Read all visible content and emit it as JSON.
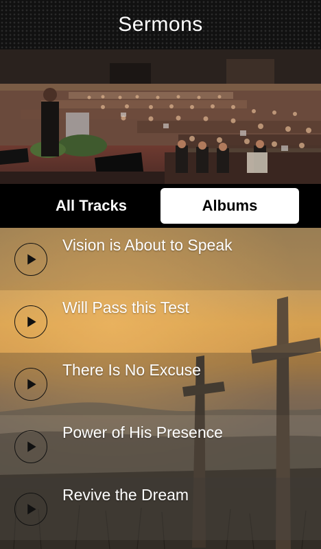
{
  "header": {
    "title": "Sermons"
  },
  "banner": {
    "icon": "church-congregation-photo"
  },
  "tabs": [
    {
      "label": "All Tracks",
      "active": false
    },
    {
      "label": "Albums",
      "active": true
    }
  ],
  "tracks": [
    {
      "title": "Vision is About to Speak",
      "icon": "play-icon"
    },
    {
      "title": "Will Pass this Test",
      "icon": "play-icon"
    },
    {
      "title": "There Is No Excuse",
      "icon": "play-icon"
    },
    {
      "title": "Power of His Presence",
      "icon": "play-icon"
    },
    {
      "title": "Revive the Dream",
      "icon": "play-icon"
    }
  ],
  "colors": {
    "tab_active_bg": "#ffffff",
    "tab_active_text": "#000000",
    "accent_sunset": "#d29a48"
  }
}
